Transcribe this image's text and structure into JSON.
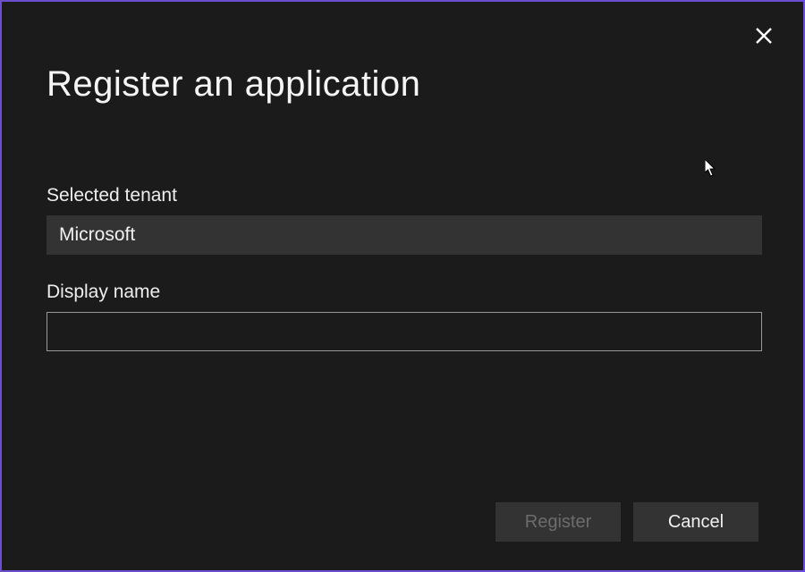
{
  "dialog": {
    "title": "Register an application",
    "tenant_label": "Selected tenant",
    "tenant_value": "Microsoft",
    "displayname_label": "Display name",
    "displayname_value": "",
    "register_label": "Register",
    "cancel_label": "Cancel"
  }
}
